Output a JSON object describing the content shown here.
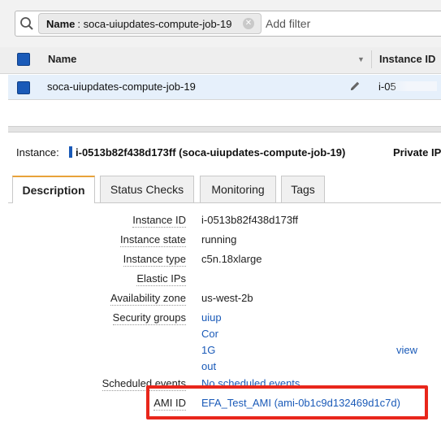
{
  "filter": {
    "chip_key": "Name",
    "chip_value": ": soca-uiupdates-compute-job-19",
    "add_placeholder": "Add filter"
  },
  "table": {
    "columns": [
      "Name",
      "Instance ID"
    ],
    "row": {
      "name": "soca-uiupdates-compute-job-19",
      "instance_id": "i-05"
    }
  },
  "detail": {
    "instance_label": "Instance:",
    "instance_value": "i-0513b82f438d173ff (soca-uiupdates-compute-job-19)",
    "private_label": "Private IP",
    "tabs": [
      "Description",
      "Status Checks",
      "Monitoring",
      "Tags"
    ],
    "fields": {
      "instance_id": {
        "label": "Instance ID",
        "value": "i-0513b82f438d173ff"
      },
      "instance_state": {
        "label": "Instance state",
        "value": "running"
      },
      "instance_type": {
        "label": "Instance type",
        "value": "c5n.18xlarge"
      },
      "elastic_ips": {
        "label": "Elastic IPs",
        "value": ""
      },
      "availability_zone": {
        "label": "Availability zone",
        "value": "us-west-2b"
      },
      "security_groups": {
        "label": "Security groups",
        "lines": [
          "uiup",
          "Cor",
          "1G",
          "out"
        ],
        "extra_link": "view"
      },
      "scheduled_events": {
        "label": "Scheduled events",
        "value": "No scheduled events"
      },
      "ami_id": {
        "label": "AMI ID",
        "value": "EFA_Test_AMI (ami-0b1c9d132469d1c7d)"
      }
    }
  },
  "colors": {
    "accent": "#1a5ab8",
    "highlight": "#e8261b",
    "tab_active": "#e8a23a"
  }
}
